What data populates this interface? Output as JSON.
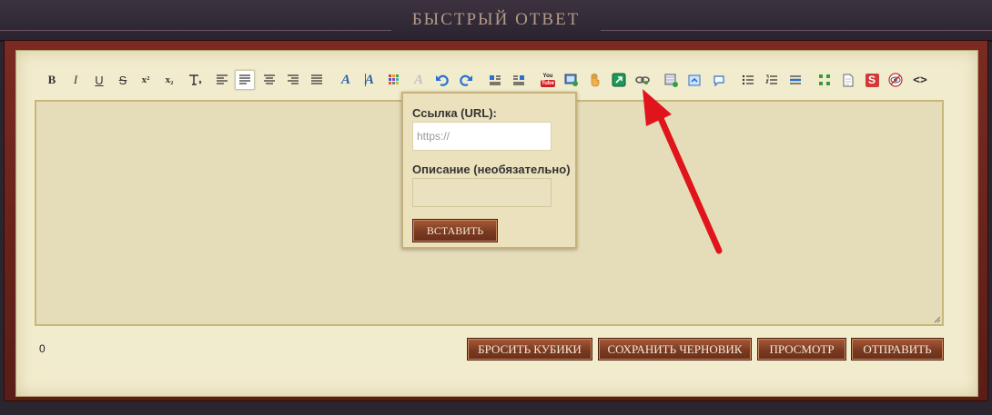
{
  "header": {
    "title": "БЫСТРЫЙ ОТВЕТ"
  },
  "toolbar": {
    "bold": "B",
    "italic": "I",
    "underline": "U",
    "strike": "S",
    "superscript": "x²",
    "subscript": "x₂",
    "font_color_letter": "A",
    "font_bg_letter": "A",
    "youtube_top": "You",
    "youtube_bottom": "Tube",
    "stop_letter": "S",
    "source_code": "<>"
  },
  "link_popup": {
    "url_label": "Ссылка (URL):",
    "url_placeholder": "https://",
    "description_label": "Описание (необязательно)",
    "description_value": "",
    "insert_button": "ВСТАВИТЬ"
  },
  "editor": {
    "content": "",
    "char_count": "0"
  },
  "actions": {
    "roll_dice": "БРОСИТЬ КУБИКИ",
    "save_draft": "СОХРАНИТЬ ЧЕРНОВИК",
    "preview": "ПРОСМОТР",
    "submit": "ОТПРАВИТЬ"
  },
  "colors": {
    "frame": "#6b231c",
    "parchment": "#f2ecce",
    "editor_bg": "#e5ddba",
    "button": "#8a4328",
    "arrow": "#e0141b"
  }
}
